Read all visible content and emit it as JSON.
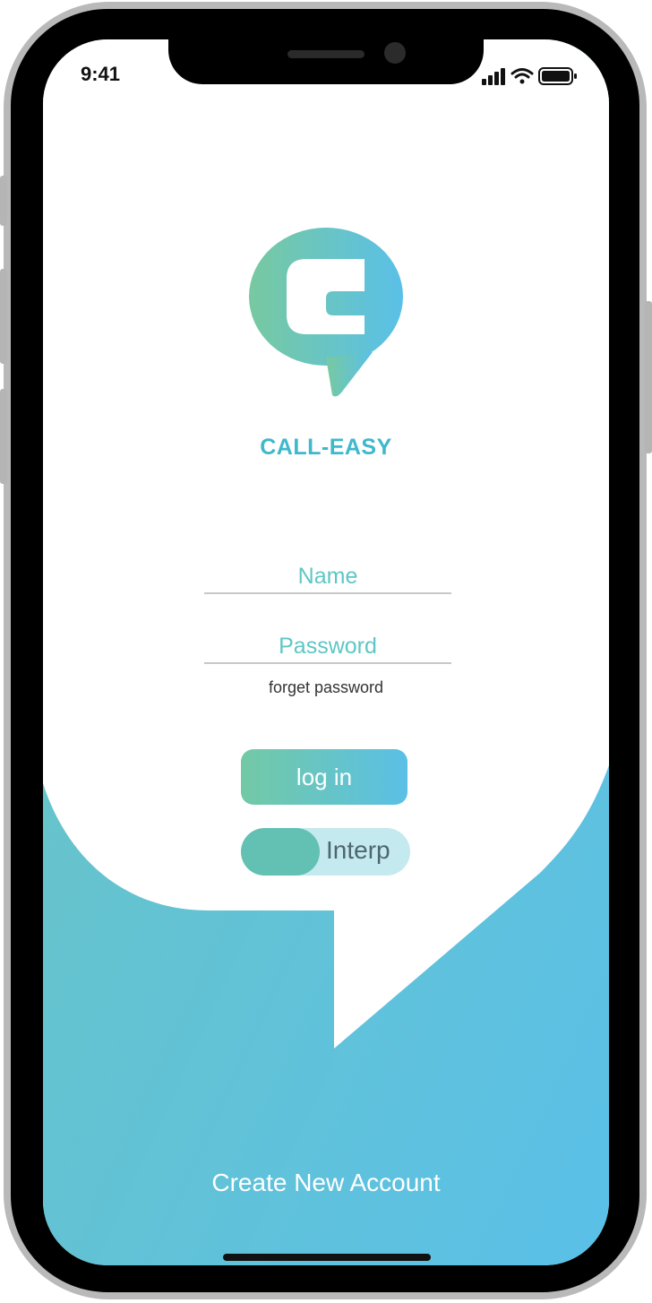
{
  "status_bar": {
    "time": "9:41",
    "icons": [
      "cellular-signal-icon",
      "wifi-icon",
      "battery-icon"
    ]
  },
  "app": {
    "logo_icon": "chat-bubble-c-logo-icon",
    "brand_name": "CALL-EASY"
  },
  "login_form": {
    "name_placeholder": "Name",
    "password_placeholder": "Password",
    "name_value": "",
    "password_value": "",
    "forget_password_label": "forget password",
    "login_label": "log in"
  },
  "interp_toggle": {
    "label": "Interp",
    "on": false
  },
  "footer": {
    "create_account_label": "Create New Account"
  },
  "colors": {
    "brand": "#3fb8cd",
    "gradient_start": "#73c9a5",
    "gradient_end": "#5ac0e6",
    "toggle_track": "#c4e9ee",
    "toggle_knob": "#63c1b4"
  }
}
